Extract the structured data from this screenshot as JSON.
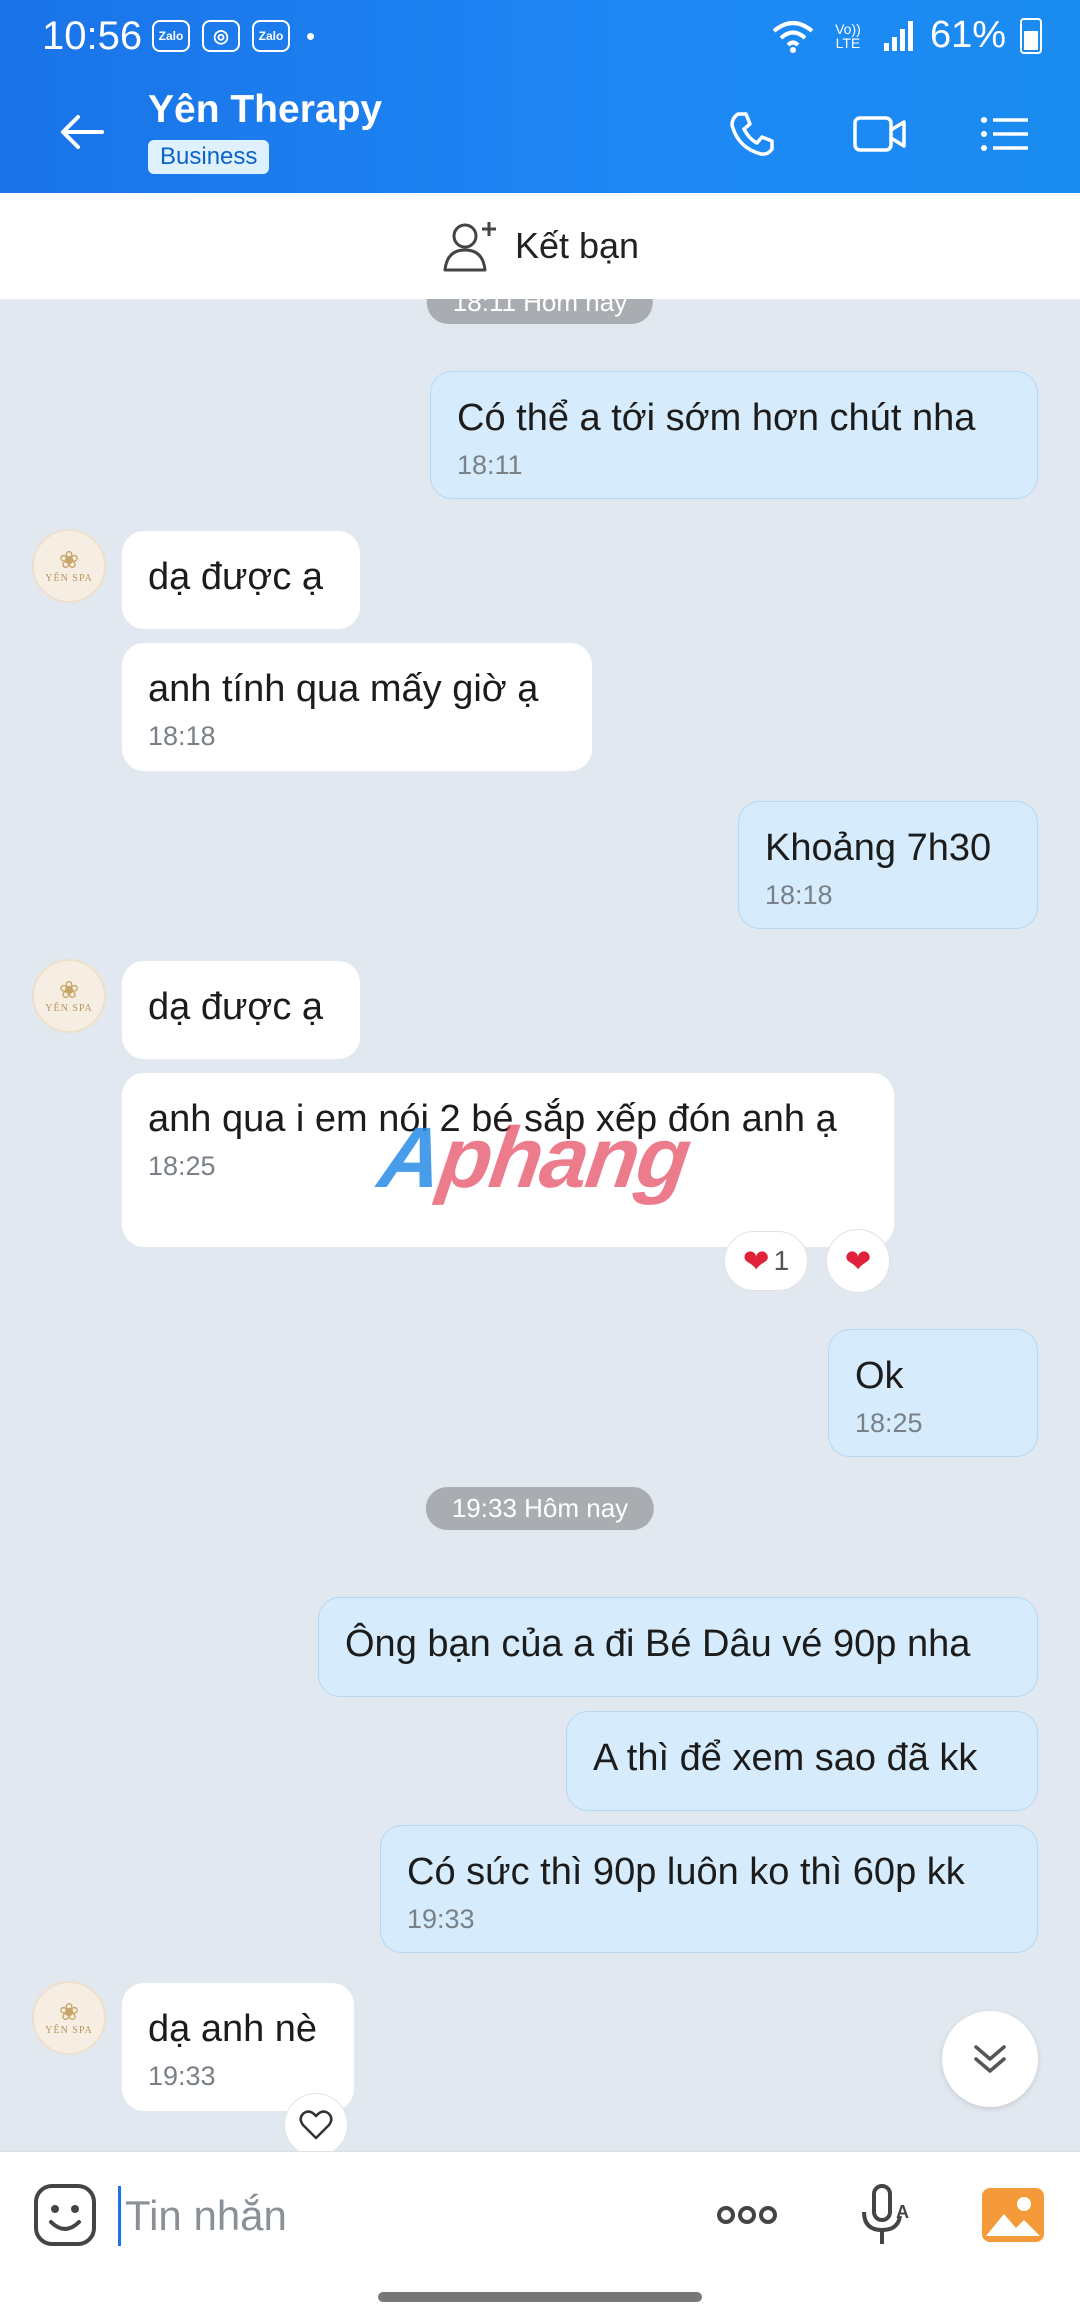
{
  "status_bar": {
    "time": "10:56",
    "lte": "Vo)) LTE",
    "battery": "61%",
    "app_icons": [
      "Zalo",
      "Instagram",
      "Zalo"
    ]
  },
  "header": {
    "title": "Yên Therapy",
    "badge": "Business"
  },
  "add_friend": {
    "label": "Kết bạn"
  },
  "avatar": {
    "brand": "YÊN SPA"
  },
  "separators": [
    "18:11 Hôm nay",
    "19:33 Hôm nay"
  ],
  "messages": [
    {
      "dir": "out",
      "text": "Có thể a tới sớm hơn chút nha",
      "time": "18:11"
    },
    {
      "dir": "in",
      "text": "dạ được ạ",
      "time": ""
    },
    {
      "dir": "in",
      "text": "anh tính qua mấy giờ ạ",
      "time": "18:18"
    },
    {
      "dir": "out",
      "text": "Khoảng 7h30",
      "time": "18:18"
    },
    {
      "dir": "in",
      "text": "dạ được ạ",
      "time": ""
    },
    {
      "dir": "in",
      "text": "anh qua i em nói 2 bé sắp xếp đón anh ạ",
      "time": "18:25"
    },
    {
      "dir": "out",
      "text": "Ok",
      "time": "18:25"
    },
    {
      "dir": "out",
      "text": "Ông bạn của a đi Bé Dâu vé 90p nha",
      "time": ""
    },
    {
      "dir": "out",
      "text": "A thì để xem sao đã kk",
      "time": ""
    },
    {
      "dir": "out",
      "text": "Có sức thì 90p luôn ko thì 60p kk",
      "time": "19:33"
    },
    {
      "dir": "in",
      "text": "dạ anh nè",
      "time": "19:33"
    }
  ],
  "reactions": {
    "count": "1"
  },
  "watermark": {
    "part1": "A",
    "part2": "phang"
  },
  "input": {
    "placeholder": "Tin nhắn"
  },
  "colors": {
    "header": "#1a73e8",
    "out_bubble": "#d6ecfc",
    "chat_bg": "#e2e8f0",
    "heart": "#e0233a"
  }
}
